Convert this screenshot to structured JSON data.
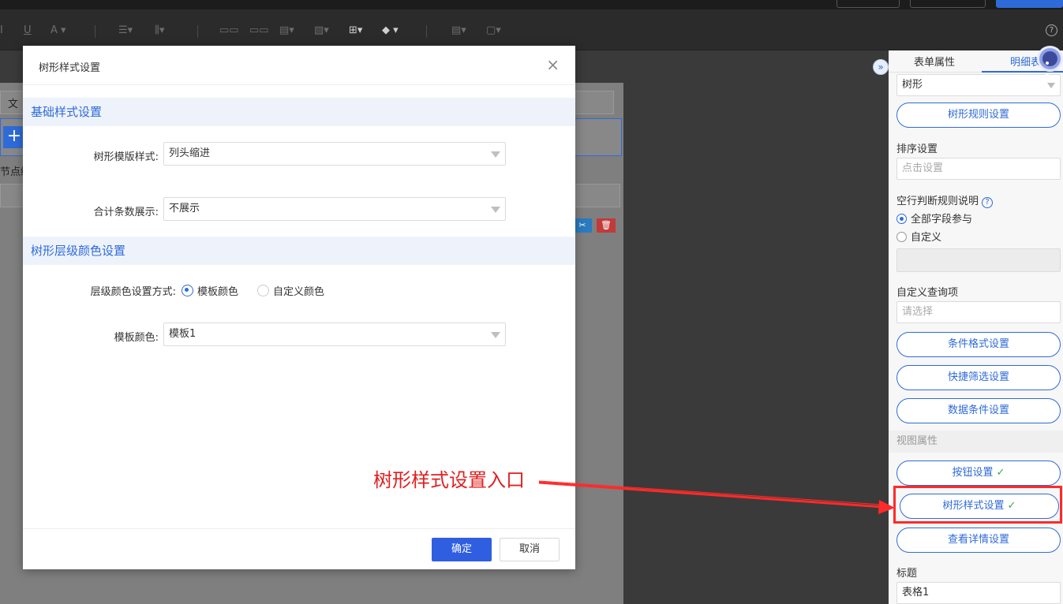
{
  "dialog": {
    "title": "树形样式设置",
    "close_icon": "×",
    "section_basic": "基础样式设置",
    "section_color": "树形层级颜色设置",
    "template_style_label": "树形模版样式:",
    "template_style_value": "列头缩进",
    "total_count_label": "合计条数展示:",
    "total_count_value": "不展示",
    "color_mode_label": "层级颜色设置方式:",
    "color_mode_options": [
      "模板颜色",
      "自定义颜色"
    ],
    "color_mode_selected": "模板颜色",
    "template_color_label": "模板颜色:",
    "template_color_value": "模板1",
    "ok_label": "确定",
    "cancel_label": "取消"
  },
  "right_panel": {
    "tabs": [
      "表单属性",
      "明细表"
    ],
    "active_tab": "明细表",
    "tree_select_value": "树形",
    "tree_rule_button": "树形规则设置",
    "sort_label": "排序设置",
    "sort_placeholder": "点击设置",
    "empty_row_label": "空行判断规则说明",
    "empty_row_help": "?",
    "empty_row_options": [
      "全部字段参与",
      "自定义"
    ],
    "empty_row_selected": "全部字段参与",
    "custom_query_label": "自定义查询项",
    "custom_query_placeholder": "请选择",
    "condition_format_button": "条件格式设置",
    "quick_filter_button": "快捷筛选设置",
    "data_condition_button": "数据条件设置",
    "view_section": "视图属性",
    "button_setting": "按钮设置",
    "tree_style_setting": "树形样式设置",
    "detail_view_setting": "查看详情设置",
    "title_label": "标题",
    "title_value": "表格1"
  },
  "background": {
    "file_tab_fragment": "文",
    "node_fragment": "节点编"
  },
  "annotation": {
    "text": "树形样式设置入口",
    "color": "#e02020"
  },
  "colors": {
    "accent": "#2f6bd8",
    "primary_button": "#2f5fe0",
    "check": "#3aa65a"
  }
}
